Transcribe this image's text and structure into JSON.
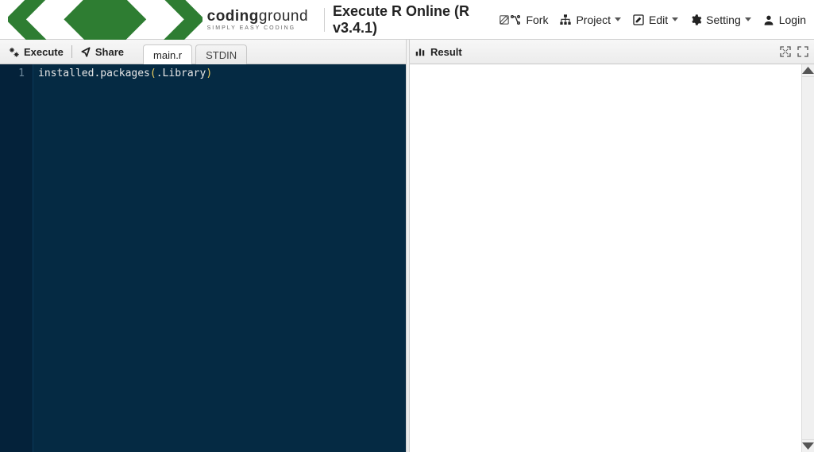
{
  "brand": {
    "name_a": "coding",
    "name_b": "ground",
    "tagline": "SIMPLY EASY CODING"
  },
  "page_title": "Execute R Online (R v3.4.1)",
  "top_actions": {
    "fork": "Fork",
    "project": "Project",
    "edit": "Edit",
    "setting": "Setting",
    "login": "Login"
  },
  "left_toolbar": {
    "execute": "Execute",
    "share": "Share"
  },
  "tabs": [
    {
      "label": "main.r",
      "active": true
    },
    {
      "label": "STDIN",
      "active": false
    }
  ],
  "editor": {
    "lines": [
      {
        "num": "1",
        "code": {
          "fn": "installed.packages",
          "open": "(",
          "arg": ".Library",
          "close": ")"
        }
      }
    ]
  },
  "right_panel": {
    "result_label": "Result"
  }
}
